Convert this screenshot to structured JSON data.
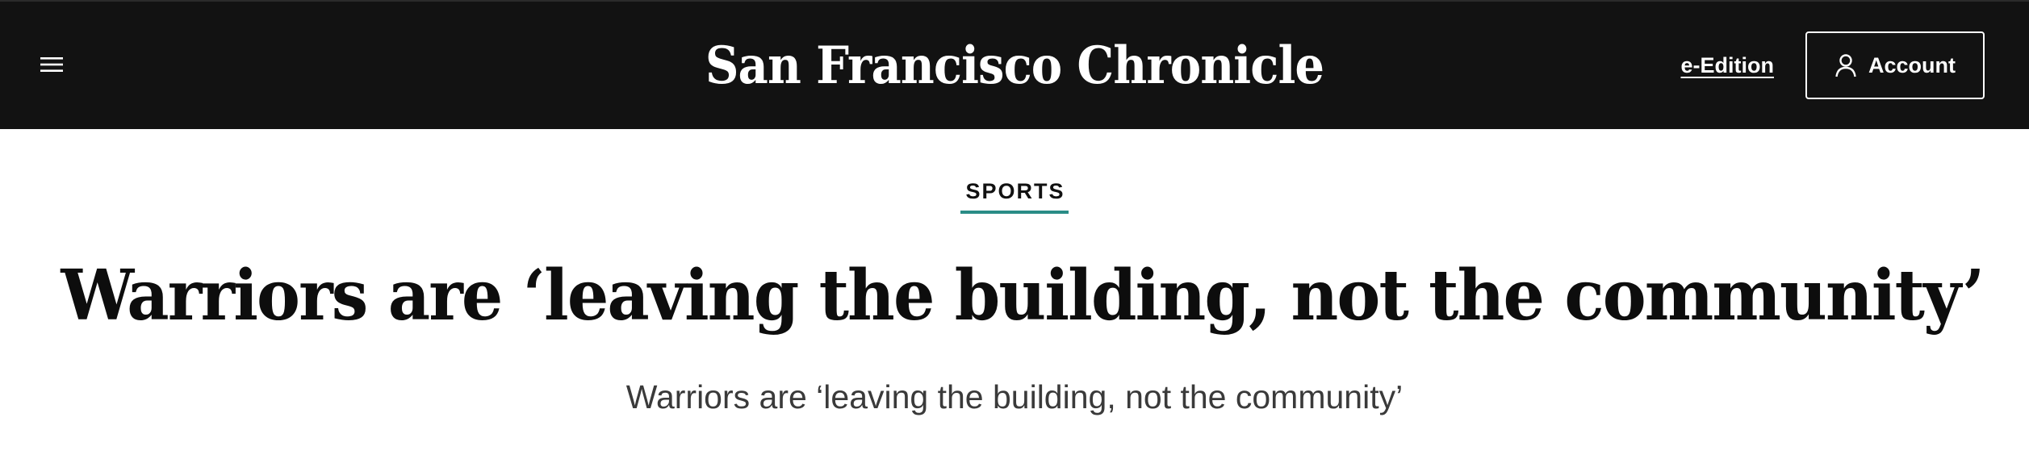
{
  "header": {
    "masthead": "San Francisco Chronicle",
    "eedition_label": "e-Edition",
    "account_label": "Account",
    "menu_icon": "hamburger-menu-icon",
    "account_icon": "user-icon",
    "background_color": "#121212"
  },
  "article": {
    "section": "SPORTS",
    "section_accent_color": "#2a8c86",
    "headline": "Warriors are ‘leaving the building, not the community’",
    "subheadline": "Warriors are ‘leaving the building, not the community’"
  }
}
